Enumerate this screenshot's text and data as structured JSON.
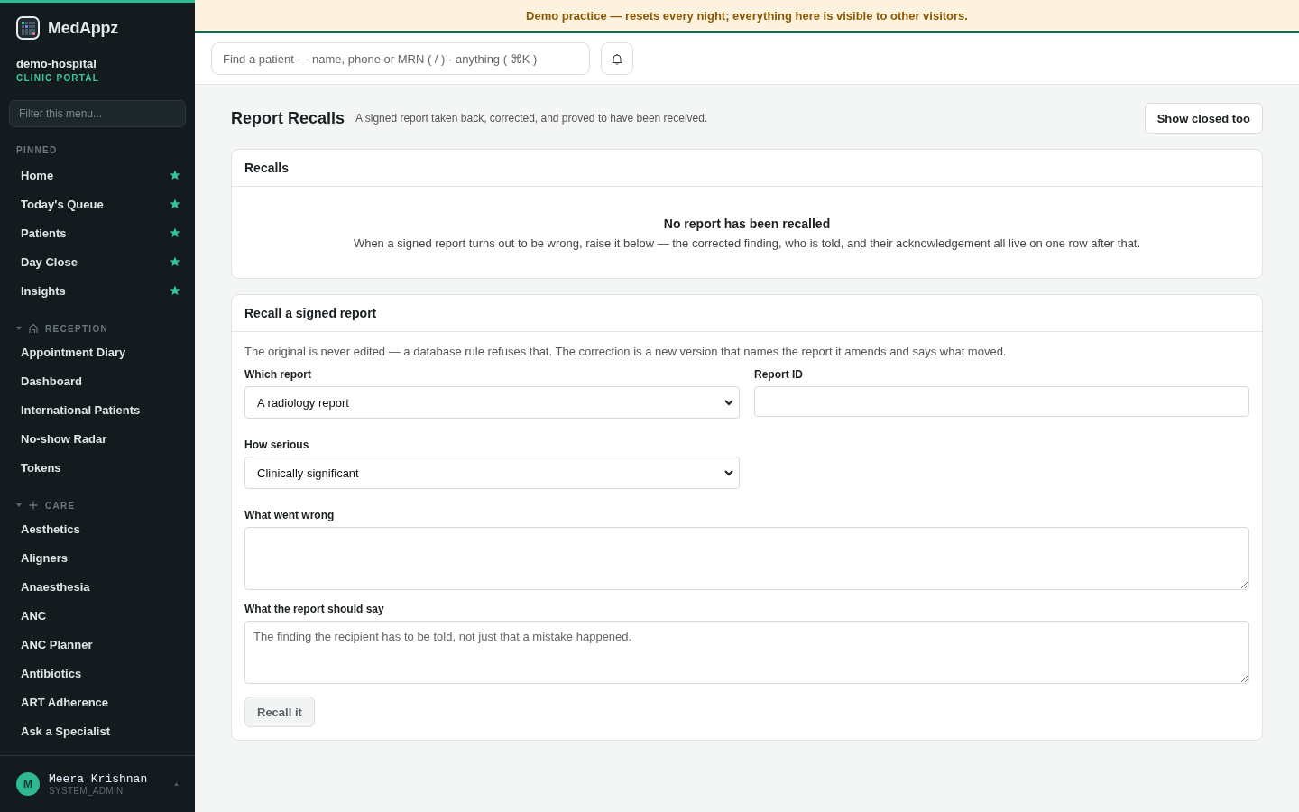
{
  "brand": {
    "name": "MedAppz",
    "org": "demo-hospital",
    "portal": "CLINIC PORTAL"
  },
  "sidebar": {
    "filter_placeholder": "Filter this menu...",
    "groups": [
      {
        "kind": "pinned",
        "label": "PINNED",
        "items": [
          {
            "label": "Home",
            "starred": true
          },
          {
            "label": "Today's Queue",
            "starred": true
          },
          {
            "label": "Patients",
            "starred": true
          },
          {
            "label": "Day Close",
            "starred": true
          },
          {
            "label": "Insights",
            "starred": true
          }
        ]
      },
      {
        "kind": "section",
        "label": "RECEPTION",
        "expanded": true,
        "items": [
          {
            "label": "Appointment Diary",
            "starred": false
          },
          {
            "label": "Dashboard",
            "starred": false
          },
          {
            "label": "International Patients",
            "starred": false
          },
          {
            "label": "No-show Radar",
            "starred": false
          },
          {
            "label": "Tokens",
            "starred": false
          }
        ]
      },
      {
        "kind": "section",
        "label": "CARE",
        "expanded": true,
        "items": [
          {
            "label": "Aesthetics",
            "starred": false
          },
          {
            "label": "Aligners",
            "starred": false
          },
          {
            "label": "Anaesthesia",
            "starred": false
          },
          {
            "label": "ANC",
            "starred": false
          },
          {
            "label": "ANC Planner",
            "starred": false
          },
          {
            "label": "Antibiotics",
            "starred": false
          },
          {
            "label": "ART Adherence",
            "starred": false
          },
          {
            "label": "Ask a Specialist",
            "starred": false
          }
        ]
      }
    ],
    "user": {
      "initial": "M",
      "name": "Meera Krishnan",
      "role": "SYSTEM_ADMIN"
    }
  },
  "banner": "Demo practice — resets every night; everything here is visible to other visitors.",
  "search": {
    "placeholder": "Find a patient — name, phone or MRN ( / ) · anything ( ⌘K )"
  },
  "page": {
    "title": "Report Recalls",
    "subtitle": "A signed report taken back, corrected, and proved to have been received.",
    "toggle_button": "Show closed too"
  },
  "recalls": {
    "title": "Recalls",
    "empty_title": "No report has been recalled",
    "empty_text": "When a signed report turns out to be wrong, raise it below — the corrected finding, who is told, and their acknowledgement all live on one row after that."
  },
  "form": {
    "title": "Recall a signed report",
    "intro": "The original is never edited — a database rule refuses that. The correction is a new version that names the report it amends and says what moved.",
    "fields": [
      {
        "kind": "select",
        "label": "Which report",
        "value": "A radiology report"
      },
      {
        "kind": "text",
        "label": "Report ID"
      },
      {
        "kind": "select",
        "label": "How serious",
        "value": "Clinically significant"
      },
      {
        "kind": "textarea",
        "label": "What went wrong"
      },
      {
        "kind": "textarea",
        "label": "What the report should say",
        "placeholder": "The finding the recipient has to be told, not just that a mistake happened."
      }
    ],
    "submit": {
      "label": "Recall it",
      "disabled": true
    }
  }
}
